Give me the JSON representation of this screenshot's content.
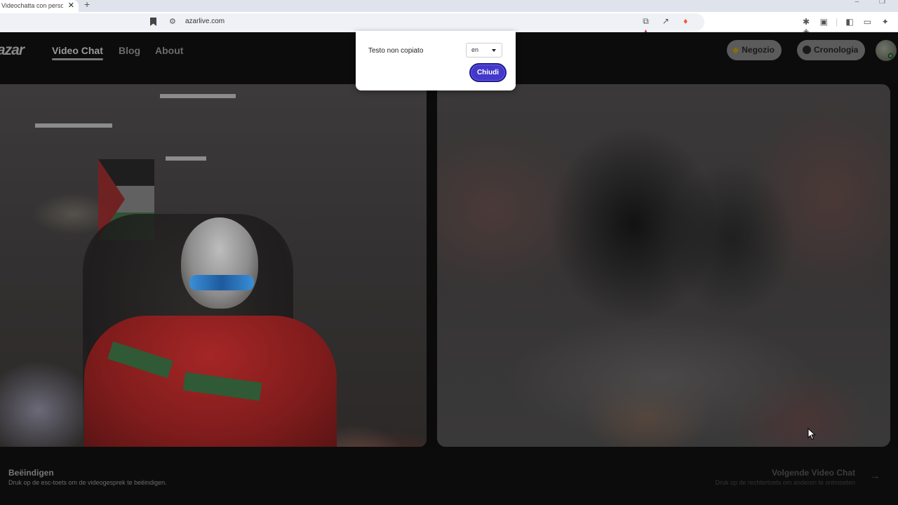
{
  "browser": {
    "tab_title": "Videochatta con persone",
    "tab_close": "✕",
    "new_tab": "+",
    "url": "azarlive.com",
    "minimize": "–",
    "restore": "❐"
  },
  "site": {
    "logo": "azar",
    "nav": [
      {
        "label": "Video Chat",
        "active": true
      },
      {
        "label": "Blog",
        "active": false
      },
      {
        "label": "About",
        "active": false
      }
    ],
    "shop_label": "Negozio",
    "history_label": "Cronologia"
  },
  "popup": {
    "message": "Testo non copiato",
    "language_value": "en",
    "close_label": "Chiudi"
  },
  "footer": {
    "end_title": "Beëindigen",
    "end_hint": "Druk op de esc-toets om de videogesprek te beëindigen.",
    "next_title": "Volgende Video Chat",
    "next_hint": "Druk op de rechtertoets om anderen te ontmoeten"
  },
  "colors": {
    "accent_button": "#4338ca",
    "shop_gem": "#8a6c0a"
  }
}
